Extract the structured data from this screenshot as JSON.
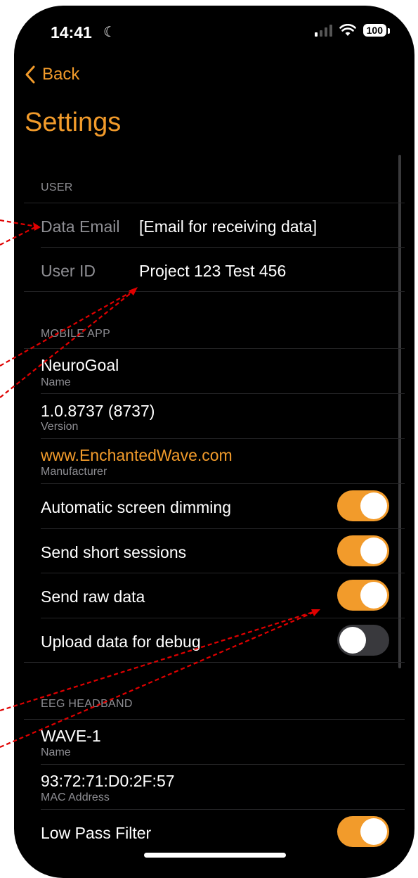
{
  "status_bar": {
    "time": "14:41",
    "battery": "100"
  },
  "nav": {
    "back_label": "Back",
    "title": "Settings"
  },
  "sections": {
    "user": {
      "header": "USER",
      "data_email": {
        "label": "Data Email",
        "value": "[Email for receiving data]"
      },
      "user_id": {
        "label": "User ID",
        "value": "Project 123 Test 456"
      }
    },
    "mobile_app": {
      "header": "MOBILE APP",
      "name": {
        "value": "NeuroGoal",
        "caption": "Name"
      },
      "version": {
        "value": "1.0.8737 (8737)",
        "caption": "Version"
      },
      "manufacturer": {
        "value": "www.EnchantedWave.com",
        "caption": "Manufacturer"
      },
      "toggles": [
        {
          "label": "Automatic screen dimming",
          "on": true
        },
        {
          "label": "Send short sessions",
          "on": true
        },
        {
          "label": "Send raw data",
          "on": true
        },
        {
          "label": "Upload data for debug",
          "on": false
        }
      ]
    },
    "eeg_headband": {
      "header": "EEG HEADBAND",
      "name": {
        "value": "WAVE-1",
        "caption": "Name"
      },
      "mac": {
        "value": "93:72:71:D0:2F:57",
        "caption": "MAC Address"
      },
      "toggles": [
        {
          "label": "Low Pass Filter",
          "on": true
        }
      ]
    }
  },
  "colors": {
    "accent": "#f29b2b",
    "background": "#000000",
    "annotation": "#e00000"
  }
}
